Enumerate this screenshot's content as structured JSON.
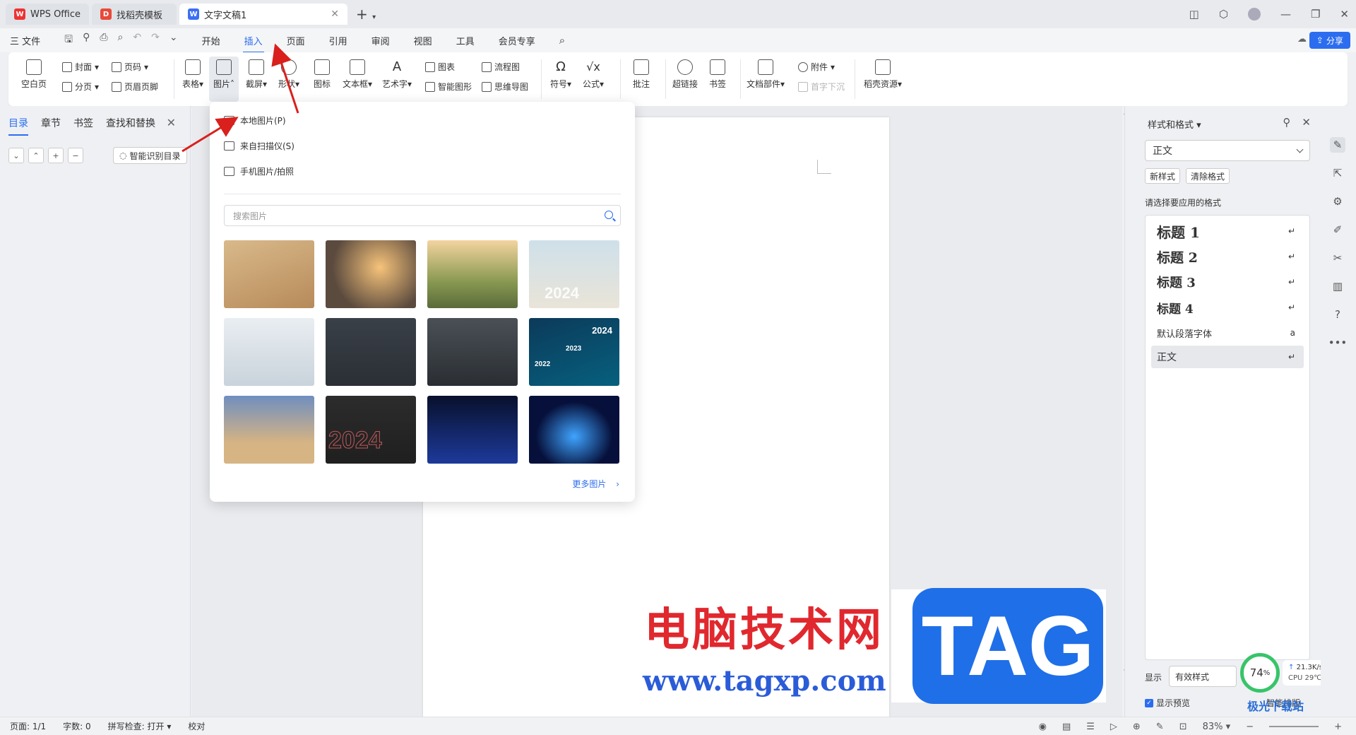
{
  "titlebar": {
    "tabs": [
      {
        "label": "WPS Office",
        "icon": "wps-logo-icon"
      },
      {
        "label": "找稻壳模板",
        "icon": "template-logo-icon"
      },
      {
        "label": "文字文稿1",
        "icon": "document-logo-icon"
      }
    ]
  },
  "menubar": {
    "file": "三 文件",
    "items": [
      "开始",
      "插入",
      "页面",
      "引用",
      "审阅",
      "视图",
      "工具",
      "会员专享"
    ],
    "active": "插入",
    "share": "分享"
  },
  "ribbon": {
    "blank_page": "空白页",
    "cover": "封面",
    "page_break": "分页",
    "page_num": "页码",
    "header_footer": "页眉页脚",
    "table": "表格",
    "picture": "图片",
    "screenshot": "截屏",
    "shape": "形状",
    "icon": "图标",
    "textbox": "文本框",
    "wordart": "艺术字",
    "chart": "图表",
    "smartart": "智能图形",
    "flowchart": "流程图",
    "mindmap": "思维导图",
    "symbol": "符号",
    "formula": "公式",
    "comment": "批注",
    "hyperlink": "超链接",
    "bookmark": "书签",
    "doc_parts": "文档部件",
    "attachment": "附件",
    "drop_cap": "首字下沉",
    "daoke": "稻壳资源"
  },
  "dropdown": {
    "items": [
      "本地图片(P)",
      "来自扫描仪(S)",
      "手机图片/拍照"
    ],
    "search_placeholder": "搜索图片",
    "more": "更多图片",
    "thumbs": [
      {
        "label": "",
        "bg": "linear-gradient(160deg,#d9b98a,#b78a5a)"
      },
      {
        "label": "",
        "bg": "radial-gradient(circle at 60% 40%,#f6c37a,#5b4a3e 70%)"
      },
      {
        "label": "",
        "bg": "linear-gradient(180deg,#f4d4a0,#8a9a52 60%,#5a6b3a)"
      },
      {
        "label": "2024",
        "bg": "linear-gradient(180deg,#cfe0ea,#e9e4d8)"
      },
      {
        "label": "",
        "bg": "linear-gradient(180deg,#e9eef2,#c9d3db)"
      },
      {
        "label": "",
        "bg": "linear-gradient(180deg,#3a4048,#2a2f35)"
      },
      {
        "label": "",
        "bg": "linear-gradient(180deg,#4a5056,#2a2e33)"
      },
      {
        "label": "2024",
        "bg": "linear-gradient(160deg,#0c3a5a,#06607e)"
      },
      {
        "label": "",
        "bg": "linear-gradient(180deg,#6f8fbf,#d7b483 70%)"
      },
      {
        "label": "2024",
        "bg": "linear-gradient(180deg,#2c2c2c,#1f1f1f)"
      },
      {
        "label": "",
        "bg": "linear-gradient(180deg,#08102c,#1d3a9a)"
      },
      {
        "label": "",
        "bg": "radial-gradient(ellipse at 50% 60%,#3fa4ff,#06103a 60%)"
      }
    ],
    "thumb_extra": {
      "y2022": "2022",
      "y2023": "2023"
    }
  },
  "leftpanel": {
    "tabs": [
      "目录",
      "章节",
      "书签",
      "查找和替换"
    ],
    "smart_toc": "智能识别目录"
  },
  "rightpanel": {
    "title": "样式和格式",
    "current": "正文",
    "new_style": "新样式",
    "clear_format": "清除格式",
    "apply_label": "请选择要应用的格式",
    "styles": [
      {
        "name": "标题 1",
        "size": "20px",
        "bold": true
      },
      {
        "name": "标题 2",
        "size": "19px",
        "bold": true
      },
      {
        "name": "标题 3",
        "size": "18px",
        "bold": true
      },
      {
        "name": "标题 4",
        "size": "17px",
        "bold": true
      },
      {
        "name": "默认段落字体",
        "size": "13px",
        "bold": false
      },
      {
        "name": "正文",
        "size": "14px",
        "bold": false
      }
    ],
    "show_label": "显示",
    "show_value": "有效样式",
    "preview": "显示预览",
    "smart_layout": "智能排版"
  },
  "statusbar": {
    "page": "页面: 1/1",
    "words": "字数: 0",
    "spell": "拼写检查: 打开",
    "proof": "校对",
    "zoom": "83%"
  },
  "watermark": {
    "title": "电脑技术网",
    "url": "www.tagxp.com",
    "tag": "TAG",
    "site": "极光下载站"
  },
  "sysmon": {
    "percent": "74",
    "net": "21.3K/s",
    "cpu": "CPU 29℃"
  }
}
